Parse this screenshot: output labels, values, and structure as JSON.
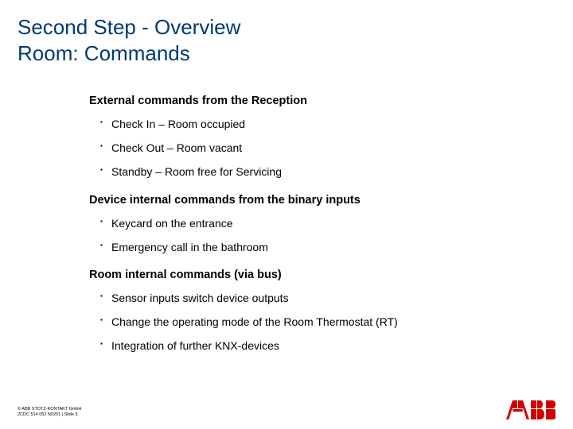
{
  "title": {
    "line1": "Second Step - Overview",
    "line2": "Room: Commands"
  },
  "sections": [
    {
      "heading": "External commands from the Reception",
      "items": [
        "Check In – Room occupied",
        "Check Out – Room vacant",
        "Standby – Room free for Servicing"
      ]
    },
    {
      "heading": "Device internal commands from the binary inputs",
      "items": [
        "Keycard on the entrance",
        "Emergency call in the bathroom"
      ]
    },
    {
      "heading": "Room internal commands (via bus)",
      "items": [
        "Sensor inputs switch device outputs",
        "Change the operating mode of the Room Thermostat (RT)",
        "Integration of further KNX-devices"
      ]
    }
  ],
  "footer": {
    "line1": "© ABB STOTZ-KONTAKT GmbH",
    "line2": "2CDC 514 052 N0201 | Slide 3"
  },
  "logo_name": "ABB"
}
